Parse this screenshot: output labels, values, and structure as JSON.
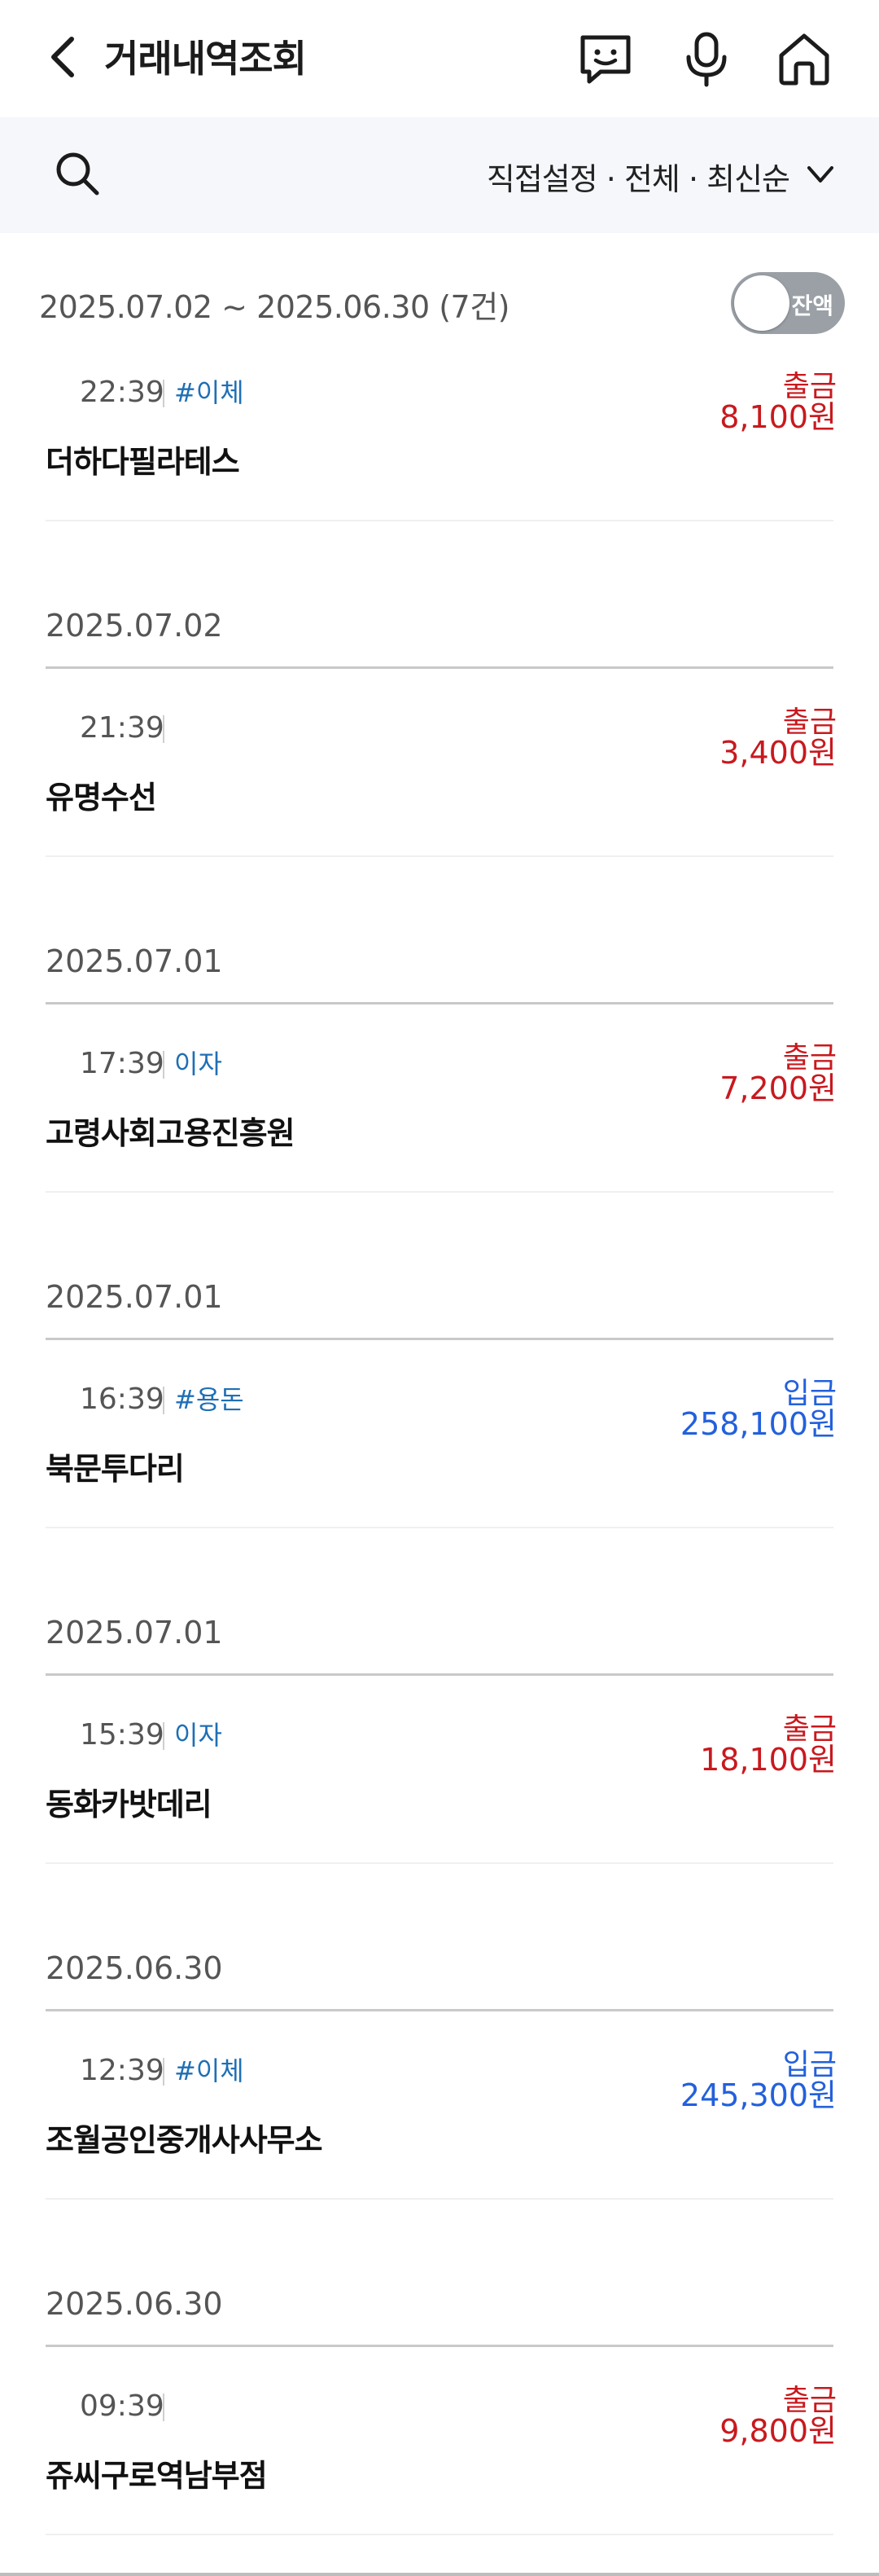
{
  "header": {
    "title": "거래내역조회",
    "icons": [
      "back-arrow-icon",
      "chat-bot-icon",
      "microphone-icon",
      "home-icon"
    ]
  },
  "searchbar": {
    "filter_label": "직접설정 · 전체 · 최신순"
  },
  "range": {
    "text": "2025.07.02 ~ 2025.06.30 (7건)",
    "balance_toggle_label": "잔액",
    "balance_toggle_on": false
  },
  "colors": {
    "withdrawal": "#c8191e",
    "deposit": "#2360dc",
    "tag": "#1f6fb5"
  },
  "transactions": [
    {
      "time": "22:39",
      "tag": "#이체",
      "name": "더하다필라테스",
      "type": "출금",
      "amount": "8,100원",
      "direction": "out",
      "date_header": ""
    },
    {
      "time": "21:39",
      "tag": "",
      "name": "유명수선",
      "type": "출금",
      "amount": "3,400원",
      "direction": "out",
      "date_header": "2025.07.02"
    },
    {
      "time": "17:39",
      "tag": "이자",
      "name": "고령사회고용진흥원",
      "type": "출금",
      "amount": "7,200원",
      "direction": "out",
      "date_header": "2025.07.01"
    },
    {
      "time": "16:39",
      "tag": "#용돈",
      "name": "북문투다리",
      "type": "입금",
      "amount": "258,100원",
      "direction": "in",
      "date_header": "2025.07.01"
    },
    {
      "time": "15:39",
      "tag": "이자",
      "name": "동화카밧데리",
      "type": "출금",
      "amount": "18,100원",
      "direction": "out",
      "date_header": "2025.07.01"
    },
    {
      "time": "12:39",
      "tag": "#이체",
      "name": "조월공인중개사사무소",
      "type": "입금",
      "amount": "245,300원",
      "direction": "in",
      "date_header": "2025.06.30"
    },
    {
      "time": "09:39",
      "tag": "",
      "name": "쥬씨구로역남부점",
      "type": "출금",
      "amount": "9,800원",
      "direction": "out",
      "date_header": "2025.06.30"
    }
  ]
}
